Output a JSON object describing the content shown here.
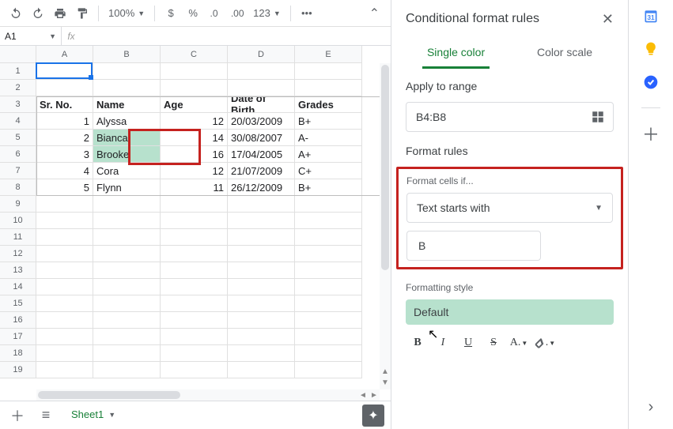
{
  "toolbar": {
    "zoom": "100%",
    "numfmt": "123"
  },
  "namebox": "A1",
  "columns": [
    "A",
    "B",
    "C",
    "D",
    "E"
  ],
  "rows_count": 19,
  "data": {
    "headers": [
      "Sr. No.",
      "Name",
      "Age",
      "Date of Birth",
      "Grades"
    ],
    "rows": [
      {
        "sr": "1",
        "name": "Alyssa",
        "age": "12",
        "dob": "20/03/2009",
        "grade": "B+",
        "hl": false
      },
      {
        "sr": "2",
        "name": "Bianca",
        "age": "14",
        "dob": "30/08/2007",
        "grade": "A-",
        "hl": true
      },
      {
        "sr": "3",
        "name": "Brooke",
        "age": "16",
        "dob": "17/04/2005",
        "grade": "A+",
        "hl": true
      },
      {
        "sr": "4",
        "name": "Cora",
        "age": "12",
        "dob": "21/07/2009",
        "grade": "C+",
        "hl": false
      },
      {
        "sr": "5",
        "name": "Flynn",
        "age": "11",
        "dob": "26/12/2009",
        "grade": "B+",
        "hl": false
      }
    ]
  },
  "sheet_tab": "Sheet1",
  "panel": {
    "title": "Conditional format rules",
    "tab_single": "Single color",
    "tab_scale": "Color scale",
    "apply_label": "Apply to range",
    "range": "B4:B8",
    "rules_label": "Format rules",
    "cells_if": "Format cells if...",
    "condition": "Text starts with",
    "value": "B",
    "style_label": "Formatting style",
    "style_preview": "Default"
  }
}
